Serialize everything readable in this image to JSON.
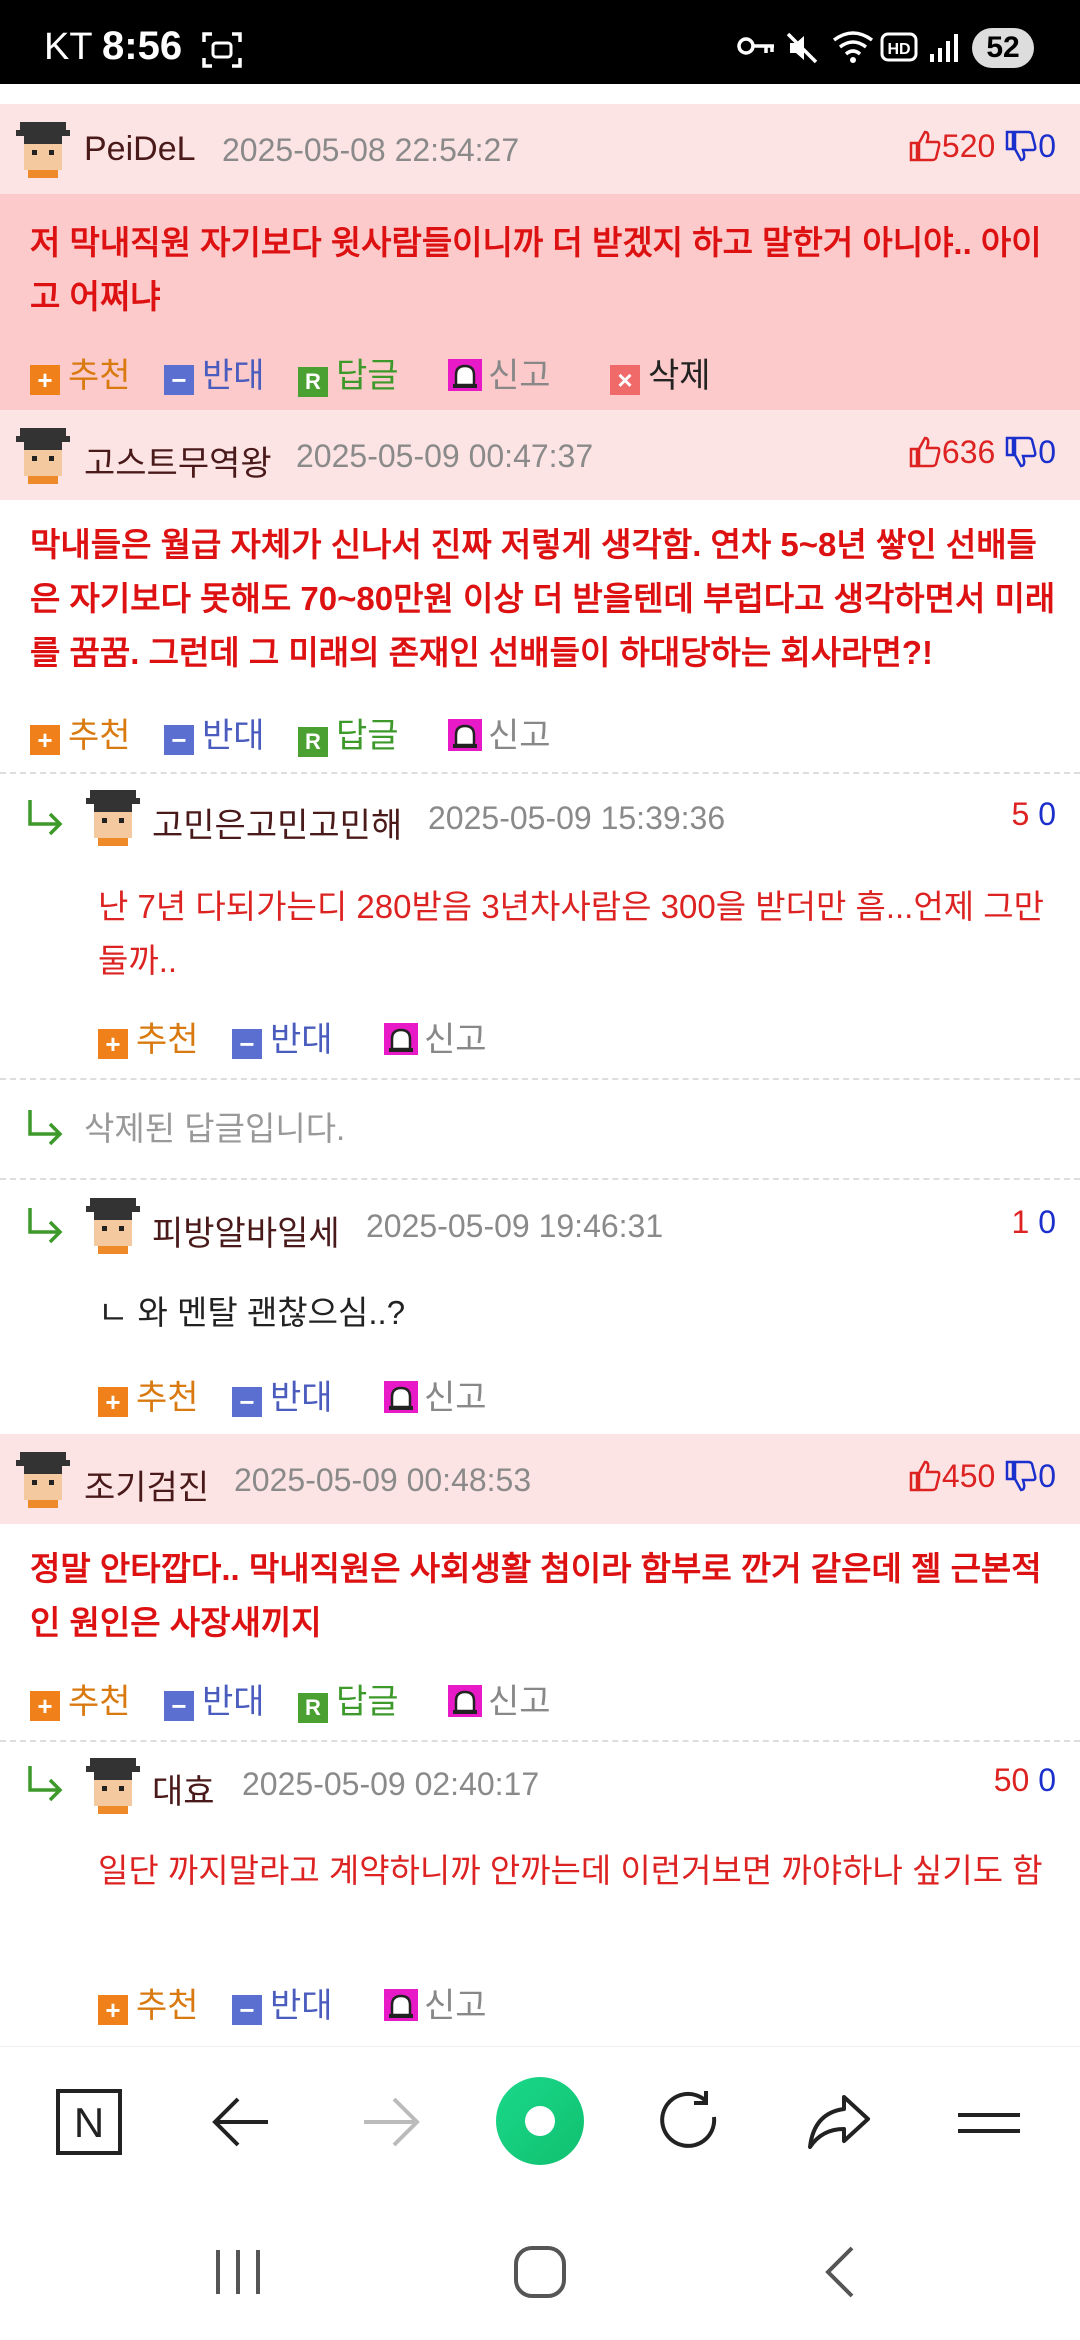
{
  "status": {
    "carrier": "KT",
    "time": "8:56",
    "battery": "52"
  },
  "comments": [
    {
      "nick": "PeiDeL",
      "date": "2025-05-08 22:54:27",
      "up": "520",
      "down": "0",
      "text": "저 막내직원 자기보다 윗사람들이니까 더 받겠지 하고 말한거 아니야.. 아이고 어쩌냐"
    },
    {
      "nick": "고스트무역왕",
      "date": "2025-05-09 00:47:37",
      "up": "636",
      "down": "0",
      "text": "막내들은 월급 자체가 신나서 진짜 저렇게 생각함. 연차 5~8년 쌓인 선배들은 자기보다 못해도 70~80만원 이상 더 받을텐데 부럽다고 생각하면서 미래를 꿈꿈. 그런데 그 미래의 존재인 선배들이 하대당하는 회사라면?!"
    },
    {
      "nick": "조기검진",
      "date": "2025-05-09 00:48:53",
      "up": "450",
      "down": "0",
      "text": "정말 안타깝다.. 막내직원은 사회생활 첨이라 함부로 깐거 같은데 젤 근본적인 원인은 사장새끼지"
    }
  ],
  "replies": [
    {
      "nick": "고민은고민고민해",
      "date": "2025-05-09 15:39:36",
      "up": "5",
      "down": "0",
      "text": "난 7년 다되가는디 280받음 3년차사람은 300을 받더만 흠...언제 그만둘까.."
    },
    {
      "deleted_text": "삭제된 답글입니다."
    },
    {
      "nick": "피방알바일세",
      "date": "2025-05-09 19:46:31",
      "up": "1",
      "down": "0",
      "text": "ㄴ 와 멘탈 괜찮으심..?"
    },
    {
      "nick": "대효",
      "date": "2025-05-09 02:40:17",
      "up": "50",
      "down": "0",
      "text": "일단 까지말라고 계약하니까 안까는데 이런거보면 까야하나 싶기도 함"
    }
  ],
  "actions": {
    "recommend": "추천",
    "oppose": "반대",
    "reply": "답글",
    "report": "신고",
    "delete": "삭제",
    "icon_plus": "+",
    "icon_minus": "−",
    "icon_reply": "R",
    "icon_x": "×"
  },
  "browser": {
    "home_letter": "N"
  },
  "colors": {
    "best_header_bg": "#fde4e4",
    "best_body_bg": "#fccaca",
    "accent_red": "#dd1111",
    "accent_blue": "#1a2fcc"
  }
}
